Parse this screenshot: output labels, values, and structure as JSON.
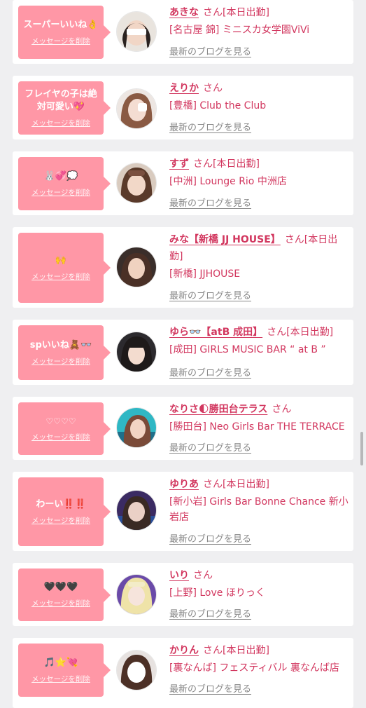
{
  "blog_link_label": "最新のブログを見る",
  "delete_label": "メッセージを削除",
  "accent_color": "#ff97a6",
  "name_color": "#d2375f",
  "items": [
    {
      "message": "スーパーいいね👌",
      "name": "あきな",
      "suffix": "さん[本日出勤]",
      "shop": "[名古屋 錦] ミニスカ女学園ViVi"
    },
    {
      "message": "フレイヤの子は絶対可愛い💖",
      "name": "えりか",
      "suffix": "さん",
      "shop": "[豊橋] Club the Club"
    },
    {
      "message": "🐰💞💭",
      "name": "すず",
      "suffix": "さん[本日出勤]",
      "shop": "[中洲] Lounge Rio 中洲店"
    },
    {
      "message": "🙌",
      "name": "みな【新橋 JJ HOUSE】",
      "suffix": "さん[本日出勤]",
      "shop": "[新橋] JJHOUSE"
    },
    {
      "message": "spいいね🧸👓",
      "name": "ゆら👓【atB 成田】",
      "suffix": "さん[本日出勤]",
      "shop": "[成田] GIRLS MUSIC BAR “ at B ”"
    },
    {
      "message": "♡♡♡♡",
      "name": "なりさ🌓勝田台テラス",
      "suffix": "さん",
      "shop": "[勝田台] Neo Girls Bar THE TERRACE"
    },
    {
      "message": "わーい‼️‼️",
      "name": "ゆりあ",
      "suffix": "さん[本日出勤]",
      "shop": "[新小岩] Girls Bar Bonne Chance 新小岩店"
    },
    {
      "message": "🖤🖤🖤",
      "name": "いり",
      "suffix": "さん",
      "shop": "[上野] Love ほりっく"
    },
    {
      "message": "🎵⭐💘",
      "name": "かりん",
      "suffix": "さん[本日出勤]",
      "shop": "[裏なんば] フェスティバル 裏なんば店"
    }
  ]
}
